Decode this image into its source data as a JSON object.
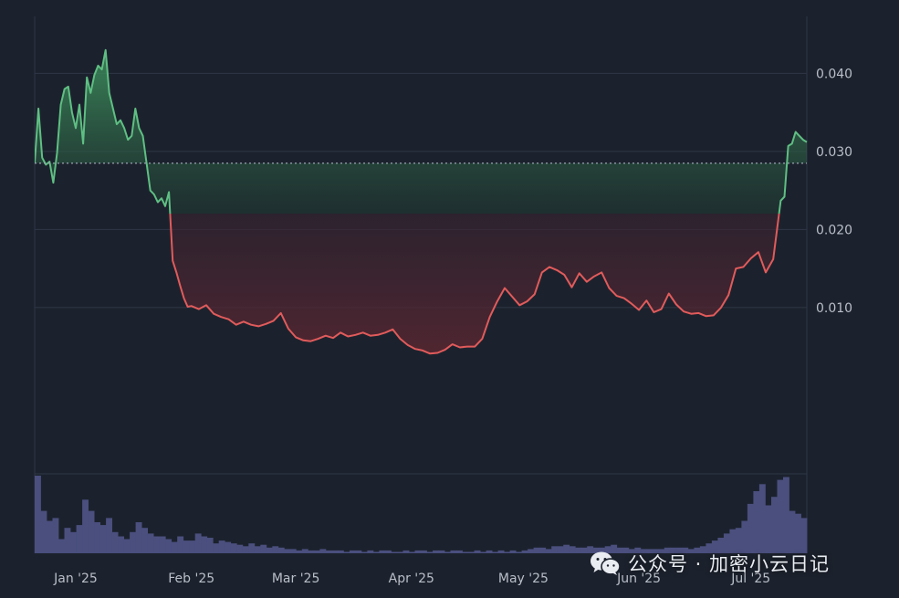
{
  "chart_data": {
    "type": "area",
    "baseline": 0.0285,
    "ylim": [
      -0.0113,
      0.0473
    ],
    "yticks": [
      0.01,
      0.02,
      0.03,
      0.04
    ],
    "ytick_labels": [
      "0.010",
      "0.020",
      "0.030",
      "0.040"
    ],
    "xlim": [
      "2024-12-21",
      "2025-07-16"
    ],
    "xticks": [
      "2025-01-01",
      "2025-02-01",
      "2025-03-01",
      "2025-04-01",
      "2025-05-01",
      "2025-06-01",
      "2025-07-01"
    ],
    "xtick_labels": [
      "Jan '25",
      "Feb '25",
      "Mar '25",
      "Apr '25",
      "May '25",
      "Jun '25",
      "Jul '25"
    ],
    "grid": true,
    "colors": {
      "above": "#5fbf83",
      "below": "#e15b5b",
      "volume": "#4a4f7e",
      "grid": "#2e3645",
      "baseline": "#9aa3b3"
    },
    "series": [
      {
        "x": [
          "2024-12-21",
          "2024-12-22",
          "2024-12-23",
          "2024-12-24",
          "2024-12-25",
          "2024-12-26",
          "2024-12-27",
          "2024-12-28",
          "2024-12-29",
          "2024-12-30",
          "2024-12-31",
          "2025-01-01",
          "2025-01-02",
          "2025-01-03",
          "2025-01-04",
          "2025-01-05",
          "2025-01-06",
          "2025-01-07",
          "2025-01-08",
          "2025-01-09",
          "2025-01-10",
          "2025-01-11",
          "2025-01-12",
          "2025-01-13",
          "2025-01-14",
          "2025-01-15",
          "2025-01-16",
          "2025-01-17",
          "2025-01-18",
          "2025-01-19",
          "2025-01-20",
          "2025-01-21",
          "2025-01-22",
          "2025-01-23",
          "2025-01-24",
          "2025-01-25",
          "2025-01-26",
          "2025-01-27",
          "2025-01-28",
          "2025-01-29",
          "2025-01-30",
          "2025-01-31",
          "2025-02-01",
          "2025-02-03",
          "2025-02-05",
          "2025-02-07",
          "2025-02-09",
          "2025-02-11",
          "2025-02-13",
          "2025-02-15",
          "2025-02-17",
          "2025-02-19",
          "2025-02-21",
          "2025-02-23",
          "2025-02-25",
          "2025-02-27",
          "2025-03-01",
          "2025-03-03",
          "2025-03-05",
          "2025-03-07",
          "2025-03-09",
          "2025-03-11",
          "2025-03-13",
          "2025-03-15",
          "2025-03-17",
          "2025-03-19",
          "2025-03-21",
          "2025-03-23",
          "2025-03-25",
          "2025-03-27",
          "2025-03-29",
          "2025-03-31",
          "2025-04-02",
          "2025-04-04",
          "2025-04-06",
          "2025-04-08",
          "2025-04-10",
          "2025-04-12",
          "2025-04-14",
          "2025-04-16",
          "2025-04-18",
          "2025-04-20",
          "2025-04-22",
          "2025-04-24",
          "2025-04-26",
          "2025-04-28",
          "2025-04-30",
          "2025-05-02",
          "2025-05-04",
          "2025-05-06",
          "2025-05-08",
          "2025-05-10",
          "2025-05-12",
          "2025-05-14",
          "2025-05-16",
          "2025-05-18",
          "2025-05-20",
          "2025-05-22",
          "2025-05-24",
          "2025-05-26",
          "2025-05-28",
          "2025-05-30",
          "2025-06-01",
          "2025-06-03",
          "2025-06-05",
          "2025-06-07",
          "2025-06-09",
          "2025-06-11",
          "2025-06-13",
          "2025-06-15",
          "2025-06-17",
          "2025-06-19",
          "2025-06-21",
          "2025-06-23",
          "2025-06-25",
          "2025-06-27",
          "2025-06-29",
          "2025-07-01",
          "2025-07-03",
          "2025-07-05",
          "2025-07-07",
          "2025-07-09",
          "2025-07-10",
          "2025-07-11",
          "2025-07-12",
          "2025-07-13",
          "2025-07-14",
          "2025-07-15",
          "2025-07-16"
        ],
        "values": [
          0.0285,
          0.0355,
          0.0292,
          0.0283,
          0.0287,
          0.026,
          0.0298,
          0.036,
          0.038,
          0.0383,
          0.035,
          0.033,
          0.036,
          0.031,
          0.0395,
          0.0375,
          0.0398,
          0.041,
          0.0405,
          0.043,
          0.0375,
          0.0355,
          0.0335,
          0.034,
          0.033,
          0.0315,
          0.032,
          0.0355,
          0.033,
          0.032,
          0.0285,
          0.025,
          0.0245,
          0.0235,
          0.024,
          0.023,
          0.0248,
          0.016,
          0.0145,
          0.0128,
          0.0112,
          0.0101,
          0.0102,
          0.0098,
          0.0103,
          0.0092,
          0.0088,
          0.0085,
          0.0078,
          0.0082,
          0.0078,
          0.0076,
          0.0079,
          0.0083,
          0.0093,
          0.0073,
          0.0062,
          0.0058,
          0.0057,
          0.006,
          0.0064,
          0.0061,
          0.0068,
          0.0063,
          0.0065,
          0.0068,
          0.0064,
          0.0065,
          0.0068,
          0.0072,
          0.006,
          0.0052,
          0.0047,
          0.0045,
          0.0041,
          0.0042,
          0.0046,
          0.0053,
          0.0049,
          0.005,
          0.005,
          0.006,
          0.0088,
          0.0108,
          0.0125,
          0.0114,
          0.0103,
          0.0108,
          0.0117,
          0.0145,
          0.0152,
          0.0148,
          0.0142,
          0.0126,
          0.0144,
          0.0133,
          0.014,
          0.0145,
          0.0125,
          0.0115,
          0.0112,
          0.0105,
          0.0097,
          0.0109,
          0.0094,
          0.0098,
          0.0118,
          0.0104,
          0.0095,
          0.0092,
          0.0093,
          0.0089,
          0.009,
          0.01,
          0.0116,
          0.015,
          0.0152,
          0.0163,
          0.0171,
          0.0145,
          0.0162,
          0.0237,
          0.0242,
          0.0307,
          0.031,
          0.0325,
          0.032,
          0.0315,
          0.0312
        ]
      }
    ],
    "volume": [
      55,
      30,
      23,
      25,
      10,
      18,
      15,
      20,
      38,
      30,
      22,
      20,
      25,
      15,
      12,
      10,
      15,
      22,
      18,
      14,
      12,
      12,
      10,
      8,
      12,
      9,
      9,
      14,
      12,
      11,
      7,
      9,
      8,
      7,
      6,
      5,
      7,
      5,
      6,
      4,
      5,
      4,
      3,
      3,
      2,
      3,
      2,
      2,
      3,
      2,
      2,
      2,
      1,
      2,
      2,
      1,
      2,
      1,
      2,
      2,
      1,
      1,
      2,
      1,
      2,
      2,
      1,
      2,
      2,
      1,
      2,
      2,
      1,
      1,
      2,
      1,
      2,
      1,
      2,
      1,
      2,
      1,
      2,
      3,
      4,
      4,
      3,
      5,
      5,
      6,
      5,
      4,
      4,
      5,
      4,
      4,
      5,
      6,
      4,
      4,
      3,
      4,
      3,
      3,
      3,
      3,
      4,
      4,
      4,
      4,
      3,
      4,
      5,
      7,
      9,
      11,
      14,
      17,
      18,
      23,
      35,
      44,
      49,
      34,
      40,
      52,
      54,
      30,
      28,
      25
    ]
  },
  "watermark": {
    "text": "公众号 · 加密小云日记",
    "icon": "wechat-icon"
  }
}
